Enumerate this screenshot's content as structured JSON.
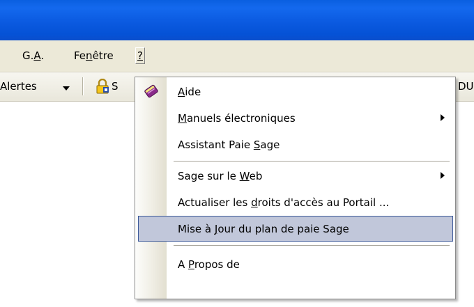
{
  "menubar": {
    "items": [
      {
        "pre": "G.",
        "u": "A",
        "post": "."
      },
      {
        "pre": "Fe",
        "u": "n",
        "post": "être"
      },
      {
        "pre": "",
        "u": "?",
        "post": ""
      }
    ]
  },
  "toolbar": {
    "alerts_label": "Alertes",
    "portal_label": "S",
    "right_label": "DU"
  },
  "dropdown": {
    "items": [
      {
        "pre": "",
        "u": "A",
        "post": "ide"
      },
      {
        "pre": "",
        "u": "M",
        "post": "anuels électroniques"
      },
      {
        "pre": "Assistant Paie ",
        "u": "S",
        "post": "age"
      },
      {
        "pre": "Sage sur le ",
        "u": "W",
        "post": "eb"
      },
      {
        "pre": "Actualiser les ",
        "u": "d",
        "post": "roits d'accès au Portail ..."
      },
      {
        "pre": "Mise à ",
        "u": "J",
        "post": "our du plan de paie Sage"
      },
      {
        "pre": "A ",
        "u": "P",
        "post": "ropos de"
      }
    ]
  },
  "colors": {
    "titlebar": "#0a5fe0",
    "menubar": "#ece9d8",
    "highlight": "#c1c7da",
    "highlight_border": "#3b5898"
  }
}
